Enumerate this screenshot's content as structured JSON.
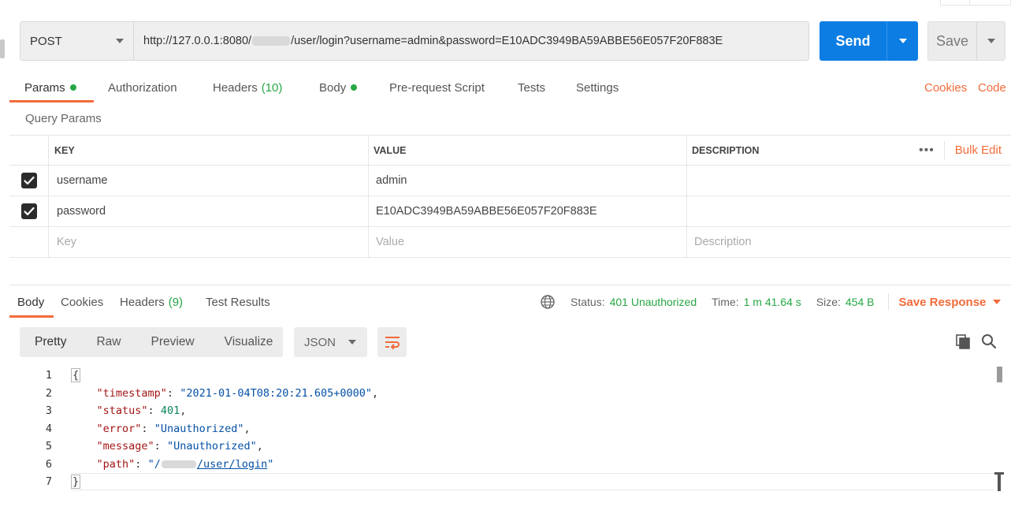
{
  "request": {
    "method": "POST",
    "url_prefix": "http://127.0.0.1:8080/",
    "url_suffix": "/user/login?username=admin&password=E10ADC3949BA59ABBE56E057F20F883E",
    "send_label": "Send",
    "save_label": "Save"
  },
  "request_tabs": [
    {
      "label": "Params",
      "dot": true
    },
    {
      "label": "Authorization"
    },
    {
      "label": "Headers",
      "count": "(10)"
    },
    {
      "label": "Body",
      "dot": true
    },
    {
      "label": "Pre-request Script"
    },
    {
      "label": "Tests"
    },
    {
      "label": "Settings"
    }
  ],
  "request_links": {
    "cookies": "Cookies",
    "code": "Code"
  },
  "query_params": {
    "title": "Query Params",
    "columns": [
      "KEY",
      "VALUE",
      "DESCRIPTION"
    ],
    "bulk_edit": "Bulk Edit",
    "more": "•••",
    "rows": [
      {
        "key": "username",
        "value": "admin",
        "description": ""
      },
      {
        "key": "password",
        "value": "E10ADC3949BA59ABBE56E057F20F883E",
        "description": ""
      }
    ],
    "placeholders": {
      "key": "Key",
      "value": "Value",
      "description": "Description"
    }
  },
  "response_tabs": [
    {
      "label": "Body"
    },
    {
      "label": "Cookies"
    },
    {
      "label": "Headers",
      "count": "(9)"
    },
    {
      "label": "Test Results"
    }
  ],
  "response_meta": {
    "status_label": "Status:",
    "status_value": "401 Unauthorized",
    "time_label": "Time:",
    "time_value": "1 m 41.64 s",
    "size_label": "Size:",
    "size_value": "454 B",
    "save_response": "Save Response"
  },
  "view_modes": [
    "Pretty",
    "Raw",
    "Preview",
    "Visualize"
  ],
  "format": "JSON",
  "response_body": {
    "line_numbers": [
      "1",
      "2",
      "3",
      "4",
      "5",
      "6",
      "7"
    ],
    "open_brace": "{",
    "close_brace": "}",
    "fields": [
      {
        "key": "\"timestamp\"",
        "value": "\"2021-01-04T08:20:21.605+0000\"",
        "type": "string",
        "comma": ","
      },
      {
        "key": "\"status\"",
        "value": "401",
        "type": "number",
        "comma": ","
      },
      {
        "key": "\"error\"",
        "value": "\"Unauthorized\"",
        "type": "string",
        "comma": ","
      },
      {
        "key": "\"message\"",
        "value": "\"Unauthorized\"",
        "type": "string",
        "comma": ","
      },
      {
        "key": "\"path\"",
        "value_prefix": "\"/",
        "value_suffix": "/user/login",
        "value_end": "\"",
        "type": "link",
        "comma": ""
      }
    ]
  },
  "colors": {
    "accent": "#f26b3a",
    "send": "#0b7de3",
    "success": "#28a745"
  }
}
